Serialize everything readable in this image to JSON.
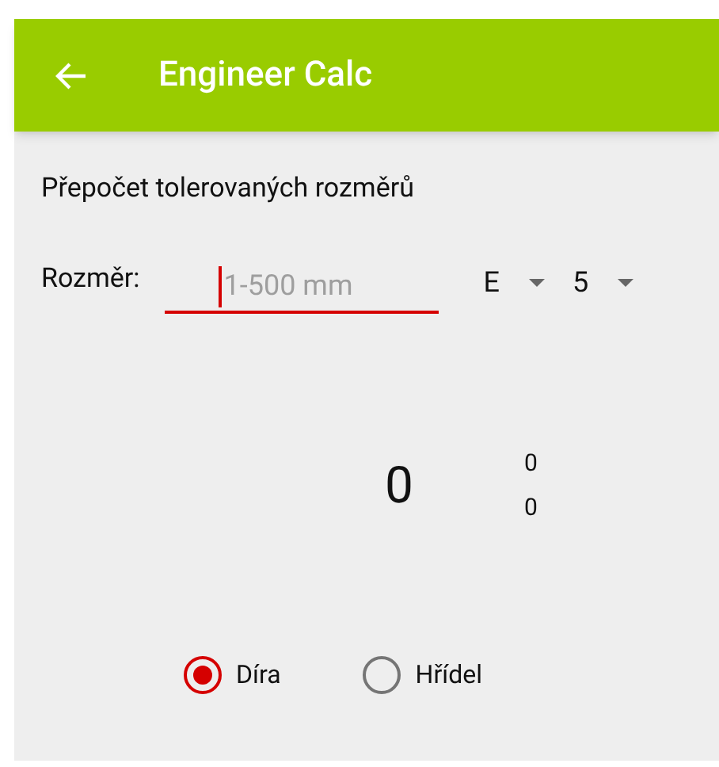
{
  "app_bar": {
    "title": "Engineer Calc"
  },
  "heading": "Přepočet tolerovaných rozměrů",
  "dimension": {
    "label": "Rozměr:",
    "placeholder": "1-500 mm",
    "focused": true
  },
  "dropdowns": [
    {
      "value": "E"
    },
    {
      "value": "5"
    }
  ],
  "result": {
    "value": "0",
    "upper_deviation": "0",
    "lower_deviation": "0"
  },
  "radios": [
    {
      "label": "Díra",
      "selected": true
    },
    {
      "label": "Hřídel",
      "selected": false
    }
  ]
}
